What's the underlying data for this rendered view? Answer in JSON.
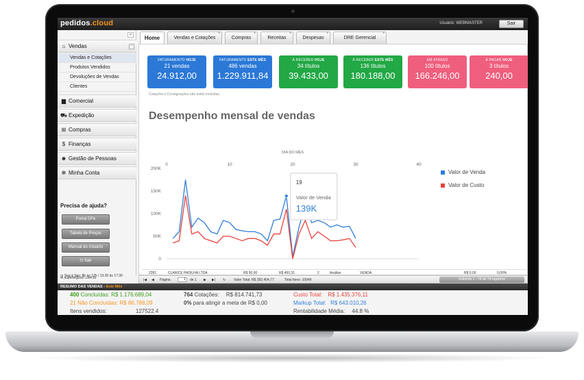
{
  "app": {
    "logo_main": "pedidos",
    "logo_accent": ".cloud",
    "user_label": "Usuário: WEBMASTER",
    "logout_label": "Sair"
  },
  "sidebar": {
    "collapse": "«",
    "vendas": {
      "label": "Vendas",
      "minus": "−",
      "items": [
        "Vendas e Cotações",
        "Produtos Vendidos",
        "Devoluções de Vendas",
        "Clientes"
      ]
    },
    "groups": [
      "Comercial",
      "Expedição",
      "Compras",
      "Finanças",
      "Gestão de Pessoas",
      "Minha Conta"
    ],
    "help_title": "Precisa de ajuda?",
    "help_buttons": [
      "Portal DFe",
      "Tabela de Preços",
      "Manual do Usuário",
      "Sair"
    ],
    "hours": "Seg à Sex: 8h às 12h / 13:30 às 17:30",
    "email": "suporte@ea7.com.br"
  },
  "tabs": [
    "Home",
    "Vendas e Cotações",
    "Compras",
    "Receitas",
    "Despesas",
    "DRE Gerencial"
  ],
  "kpis": [
    {
      "title_a": "FATURAMENTO",
      "title_b": "HOJE",
      "count": "21 vendas",
      "value": "24.912,00",
      "color": "#2b78d7"
    },
    {
      "title_a": "FATURAMENTO",
      "title_b": "ESTE MÊS",
      "count": "486 vendas",
      "value": "1.229.911,84",
      "color": "#2b78d7"
    },
    {
      "title_a": "À RECEBER",
      "title_b": "HOJE",
      "count": "34 títulos",
      "value": "39.433,00",
      "color": "#22a845"
    },
    {
      "title_a": "À RECEBER",
      "title_b": "ESTE MÊS",
      "count": "136 títulos",
      "value": "180.188,00",
      "color": "#22a845"
    },
    {
      "title_a": "EM ATRASO",
      "title_b": "",
      "count": "100 títulos",
      "value": "166.246,00",
      "color": "#ef5e7d"
    },
    {
      "title_a": "À PAGAR",
      "title_b": "HOJE",
      "count": "3 títulos",
      "value": "240,00",
      "color": "#ef5e7d"
    }
  ],
  "note": "Cotações e Consignações não estão incluídas.",
  "chart_title": "Desempenho mensal de vendas",
  "chart_data": {
    "type": "line",
    "xlabel": "DIA DO MÊS",
    "ylabel": "",
    "xlim": [
      0,
      40
    ],
    "ylim": [
      0,
      200000
    ],
    "x_ticks": [
      0,
      10,
      20,
      30,
      40
    ],
    "y_ticks": [
      0,
      50000,
      100000,
      150000,
      200000
    ],
    "y_tick_labels": [
      "0",
      "50K",
      "100K",
      "150K",
      "200K"
    ],
    "grid": false,
    "legend": "right",
    "x": [
      1,
      2,
      3,
      4,
      5,
      6,
      7,
      8,
      9,
      10,
      11,
      12,
      13,
      14,
      15,
      16,
      17,
      18,
      19,
      20,
      21,
      22,
      23,
      24,
      25,
      26,
      27,
      28,
      29,
      30,
      31
    ],
    "series": [
      {
        "name": "Valor de Venda",
        "color": "#2f7ed8",
        "values": [
          45000,
          60000,
          175000,
          70000,
          90000,
          80000,
          60000,
          55000,
          85000,
          80000,
          65000,
          62000,
          60000,
          60000,
          55000,
          40000,
          85000,
          88000,
          139000,
          5000,
          70000,
          120000,
          80000,
          85000,
          80000,
          70000,
          75000,
          70000,
          72000,
          45000,
          null
        ]
      },
      {
        "name": "Valor de Custo",
        "color": "#e8423c",
        "values": [
          35000,
          40000,
          140000,
          55000,
          60000,
          45000,
          40000,
          35000,
          50000,
          50000,
          45000,
          40000,
          45000,
          45000,
          40000,
          30000,
          55000,
          55000,
          110000,
          0,
          55000,
          85000,
          45000,
          60000,
          50000,
          40000,
          40000,
          42000,
          45000,
          25000,
          null
        ]
      }
    ],
    "tooltip": {
      "day": "19",
      "series": "Valor de Venda",
      "value": "139K"
    }
  },
  "table_row": {
    "id": "2281",
    "client": "CLARICE PADILHA LTDA",
    "v1": "R$ 90,00",
    "v2": "R$ 450,31",
    "qty": "2",
    "status": "Análise",
    "type": "VENDA",
    "v3": "R$ 0,00",
    "pct": "0,00%"
  },
  "pager": {
    "page_label": "Página",
    "page": "1",
    "of": "de 1",
    "total": "Valor Total: R$ 282.404,77",
    "items": "Total Itens: 10049",
    "display": "Exibindo 1 - 78 de 78 registros"
  },
  "summary": {
    "title": "RESUMO DAS VENDAS",
    "period": "Este Mês",
    "concluded_n": "400",
    "concluded_label": "Concluídas:",
    "concluded_v": "R$ 1.176.689,04",
    "not_concluded_n": "21",
    "not_concluded_label": "Não Concluídas:",
    "not_concluded_v": "R$ 86.788,09",
    "items_label": "Itens vendidos:",
    "items_v": "127522.4",
    "quotes_n": "764",
    "quotes_label": "Cotações:",
    "quotes_v": "R$ 814.741,73",
    "goal_n": "0%",
    "goal_label": "para atingir a meta de",
    "goal_v": "R$ 0,00",
    "cost_label": "Custo Total:",
    "cost_v": "R$ 1.435.376,11",
    "markup_label": "Markup Total:",
    "markup_v": "R$ 643.010,26",
    "profit_label": "Rentabilidade Média:",
    "profit_v": "44.8 %"
  },
  "colors": {
    "orange": "#f7941d",
    "green": "#3d9b1a",
    "red": "#e8423c",
    "blue": "#2f7ed8"
  }
}
